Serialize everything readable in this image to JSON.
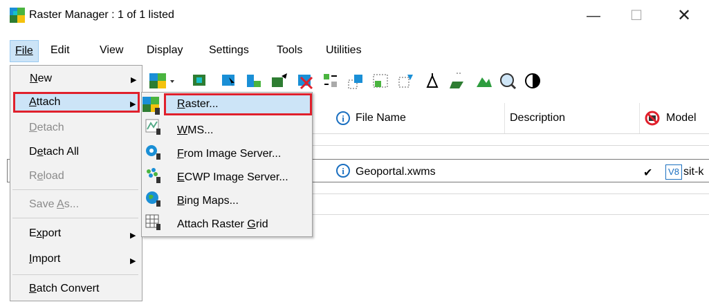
{
  "window": {
    "title": "Raster Manager : 1 of 1 listed",
    "min": "—",
    "max": "☐",
    "close": "✕"
  },
  "menubar": {
    "items": [
      "File",
      "Edit",
      "View",
      "Display",
      "Settings",
      "Tools",
      "Utilities"
    ]
  },
  "file_menu": {
    "items": [
      {
        "label": "New"
      },
      {
        "label": "Attach"
      },
      {
        "label": "Detach"
      },
      {
        "label": "Detach All"
      },
      {
        "label": "Reload"
      },
      {
        "label": "Save As..."
      },
      {
        "label": "Export"
      },
      {
        "label": "Import"
      },
      {
        "label": "Batch Convert"
      }
    ]
  },
  "attach_submenu": {
    "items": [
      {
        "label": "Raster..."
      },
      {
        "label": "WMS..."
      },
      {
        "label": "From Image Server..."
      },
      {
        "label": "ECWP Image Server..."
      },
      {
        "label": "Bing Maps..."
      },
      {
        "label": "Attach Raster Grid"
      }
    ]
  },
  "table": {
    "columns": [
      "File Name",
      "Description",
      "Model"
    ],
    "rows": [
      {
        "file_name": "Geoportal.xwms",
        "check": "✔",
        "model_badge": "V8",
        "model": "sit-k"
      }
    ]
  },
  "colors": {
    "highlight_border": "#e0202c",
    "selection_bg": "#cce4f7",
    "menu_bg": "#f2f2f2"
  }
}
